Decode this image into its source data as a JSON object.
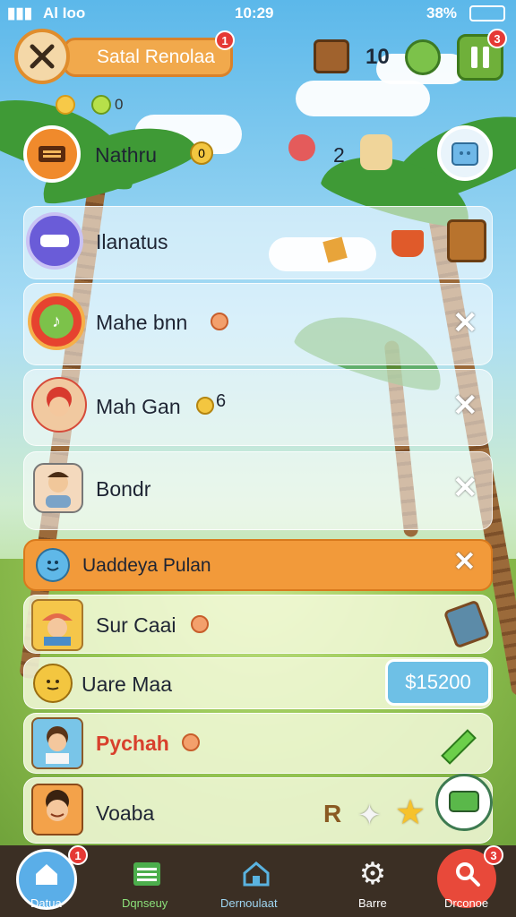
{
  "status_bar": {
    "carrier": "Al Ioo",
    "time": "10:29",
    "battery": "38%"
  },
  "header": {
    "title": "Satal Renolaa",
    "title_badge": "1",
    "resource_count": "10",
    "pause_badge": "3",
    "coin_count": "0"
  },
  "top_row": {
    "name": "Nathru",
    "token": "0",
    "helper_count": "2"
  },
  "players": [
    {
      "name": "Ilanatus"
    },
    {
      "name": "Mahe bnn"
    },
    {
      "name": "Mah Gan",
      "suffix": "6"
    },
    {
      "name": "Bondr"
    }
  ],
  "highlight": {
    "name": "Uaddeya Pulan"
  },
  "friends": [
    {
      "name": "Sur Caai"
    },
    {
      "name": "Uare Maa",
      "price": "$15200"
    },
    {
      "name": "Pychah"
    },
    {
      "name": "Voaba",
      "rank_letter": "R"
    }
  ],
  "nav": {
    "items": [
      {
        "label": "Datua",
        "badge": "1"
      },
      {
        "label": "Dqnseuy"
      },
      {
        "label": "Dernoulaat"
      },
      {
        "label": "Barre"
      },
      {
        "label": "Drconoe",
        "badge": "3"
      }
    ]
  },
  "colors": {
    "accent": "#f29a3a",
    "nav_bg": "#3b2f24",
    "pause_green": "#6fb03a"
  }
}
